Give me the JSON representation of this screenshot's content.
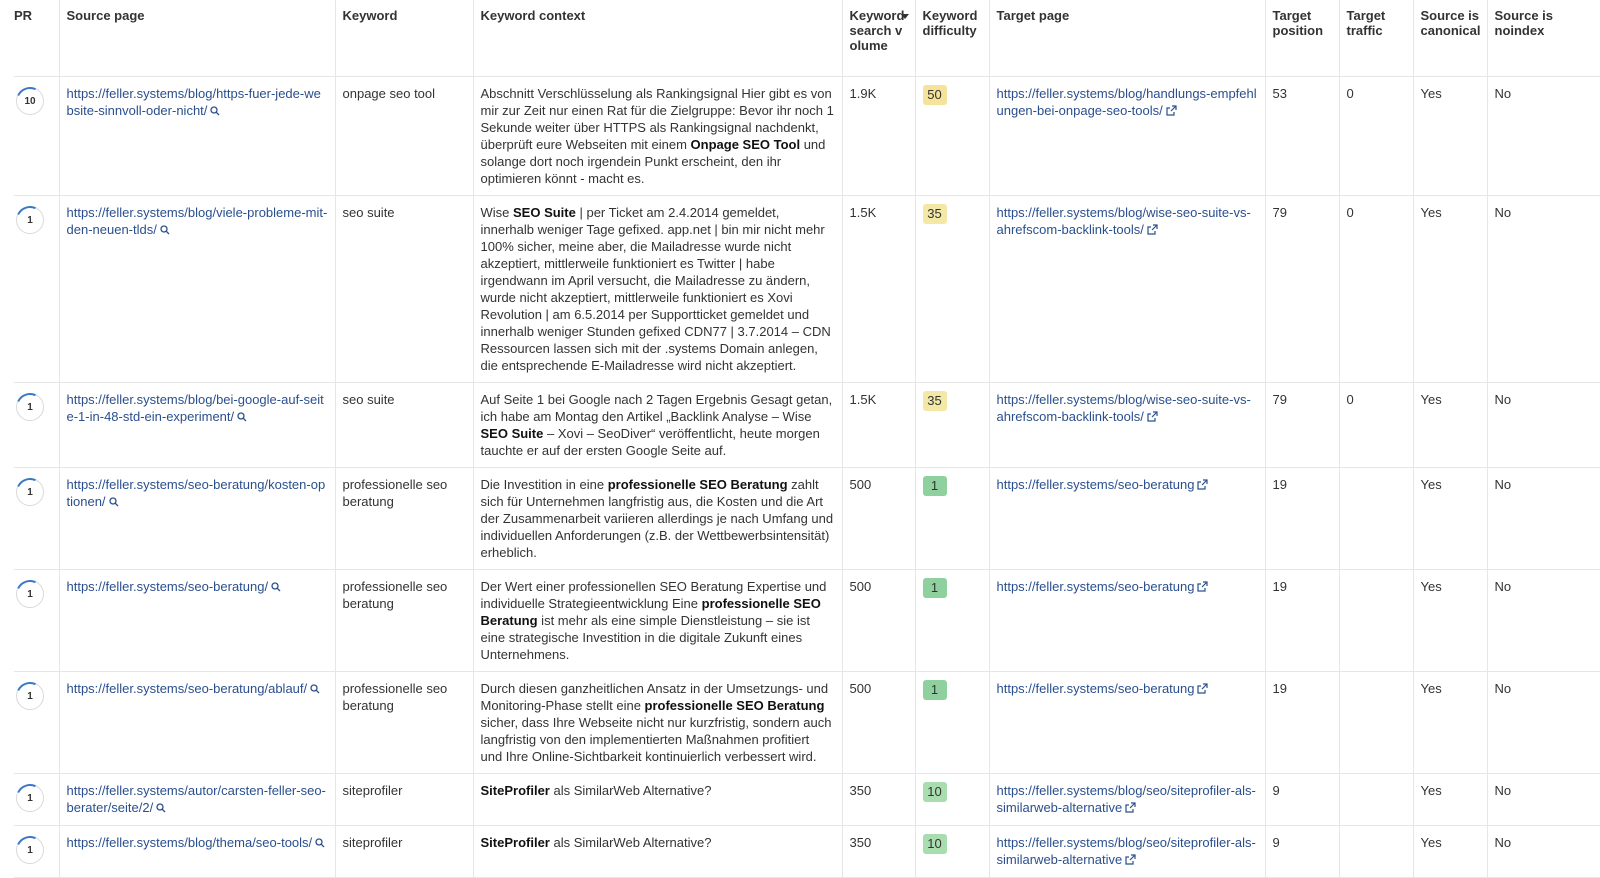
{
  "headers": {
    "pr": "PR",
    "source_page": "Source page",
    "keyword": "Keyword",
    "keyword_context": "Keyword context",
    "search_volume": "Keyword search volume",
    "difficulty": "Keyword difficulty",
    "target_page": "Target page",
    "target_position": "Target position",
    "target_traffic": "Target traffic",
    "canonical": "Source is canonical",
    "noindex": "Source is noindex"
  },
  "colors": {
    "kd_yellow": "#f5e39a",
    "kd_lightyellow": "#f3e8a6",
    "kd_green": "#8fd19e",
    "kd_lightgreen": "#a9dcae",
    "link": "#2a4f8e"
  },
  "rows": [
    {
      "pr": "10",
      "source": "https://feller.systems/blog/https-fuer-jede-website-sinnvoll-oder-nicht/",
      "keyword": "onpage seo tool",
      "context": [
        {
          "t": "Abschnitt Verschlüsselung als Rankingsignal Hier gibt es von mir zur Zeit nur einen Rat für die Zielgruppe: Bevor ihr noch 1 Sekunde weiter über HTTPS als Rankingsignal nachdenkt, überprüft eure Webseiten mit einem ",
          "b": false
        },
        {
          "t": "Onpage SEO Tool",
          "b": true
        },
        {
          "t": " und solange dort noch irgendein Punkt erscheint, den ihr optimieren könnt - macht es.",
          "b": false
        }
      ],
      "volume": "1.9K",
      "kd": "50",
      "kd_color": "#f5e39a",
      "target": "https://feller.systems/blog/handlungs-empfehlungen-bei-onpage-seo-tools/",
      "position": "53",
      "traffic": "0",
      "canonical": "Yes",
      "noindex": "No"
    },
    {
      "pr": "1",
      "source": "https://feller.systems/blog/viele-probleme-mit-den-neuen-tlds/",
      "keyword": "seo suite",
      "context": [
        {
          "t": "Wise ",
          "b": false
        },
        {
          "t": "SEO Suite",
          "b": true
        },
        {
          "t": " | per Ticket am 2.4.2014 gemeldet, innerhalb weniger Tage gefixed. app.net | bin mir nicht mehr 100% sicher, meine aber, die Mailadresse wurde nicht akzeptiert, mittlerweile funktioniert es Twitter | habe irgendwann im April versucht, die Mailadresse zu ändern, wurde nicht akzeptiert, mittlerweile funktioniert es Xovi Revolution | am 6.5.2014 per Supportticket gemeldet und innerhalb weniger Stunden gefixed CDN77 | 3.7.2014 – CDN Ressourcen lassen sich mit der .systems Domain anlegen, die entsprechende E-Mailadresse wird nicht akzeptiert.",
          "b": false
        }
      ],
      "volume": "1.5K",
      "kd": "35",
      "kd_color": "#f3e8a6",
      "target": "https://feller.systems/blog/wise-seo-suite-vs-ahrefscom-backlink-tools/",
      "position": "79",
      "traffic": "0",
      "canonical": "Yes",
      "noindex": "No"
    },
    {
      "pr": "1",
      "source": "https://feller.systems/blog/bei-google-auf-seite-1-in-48-std-ein-experiment/",
      "keyword": "seo suite",
      "context": [
        {
          "t": "Auf Seite 1 bei Google nach 2 Tagen Ergebnis Gesagt getan, ich habe am Montag den Artikel „Backlink Analyse – Wise ",
          "b": false
        },
        {
          "t": "SEO Suite",
          "b": true
        },
        {
          "t": " – Xovi – SeoDiver“ veröffentlicht, heute morgen tauchte er auf der ersten Google Seite auf.",
          "b": false
        }
      ],
      "volume": "1.5K",
      "kd": "35",
      "kd_color": "#f3e8a6",
      "target": "https://feller.systems/blog/wise-seo-suite-vs-ahrefscom-backlink-tools/",
      "position": "79",
      "traffic": "0",
      "canonical": "Yes",
      "noindex": "No"
    },
    {
      "pr": "1",
      "source": "https://feller.systems/seo-beratung/kosten-optionen/",
      "keyword": "professionelle seo beratung",
      "context": [
        {
          "t": "Die Investition in eine ",
          "b": false
        },
        {
          "t": "professionelle SEO Beratung",
          "b": true
        },
        {
          "t": " zahlt sich für Unternehmen langfristig aus, die Kosten und die Art der Zusammenarbeit variieren allerdings je nach Umfang und individuellen Anforderungen (z.B. der Wettbewerbsintensität) erheblich.",
          "b": false
        }
      ],
      "volume": "500",
      "kd": "1",
      "kd_color": "#8fd19e",
      "target": "https://feller.systems/seo-beratung",
      "position": "19",
      "traffic": "",
      "canonical": "Yes",
      "noindex": "No"
    },
    {
      "pr": "1",
      "source": "https://feller.systems/seo-beratung/",
      "keyword": "professionelle seo beratung",
      "context": [
        {
          "t": "Der Wert einer professionellen SEO Beratung Expertise und individuelle Strategieentwicklung Eine ",
          "b": false
        },
        {
          "t": "professionelle SEO Beratung",
          "b": true
        },
        {
          "t": " ist mehr als eine simple Dienstleistung – sie ist eine strategische Investition in die digitale Zukunft eines Unternehmens.",
          "b": false
        }
      ],
      "volume": "500",
      "kd": "1",
      "kd_color": "#8fd19e",
      "target": "https://feller.systems/seo-beratung",
      "position": "19",
      "traffic": "",
      "canonical": "Yes",
      "noindex": "No"
    },
    {
      "pr": "1",
      "source": "https://feller.systems/seo-beratung/ablauf/",
      "keyword": "professionelle seo beratung",
      "context": [
        {
          "t": "Durch diesen ganzheitlichen Ansatz in der Umsetzungs- und Monitoring-Phase stellt eine ",
          "b": false
        },
        {
          "t": "professionelle SEO Beratung",
          "b": true
        },
        {
          "t": " sicher, dass Ihre Webseite nicht nur kurzfristig, sondern auch langfristig von den implementierten Maßnahmen profitiert und Ihre Online-Sichtbarkeit kontinuierlich verbessert wird.",
          "b": false
        }
      ],
      "volume": "500",
      "kd": "1",
      "kd_color": "#8fd19e",
      "target": "https://feller.systems/seo-beratung",
      "position": "19",
      "traffic": "",
      "canonical": "Yes",
      "noindex": "No"
    },
    {
      "pr": "1",
      "source": "https://feller.systems/autor/carsten-feller-seo-berater/seite/2/",
      "keyword": "siteprofiler",
      "context": [
        {
          "t": "SiteProfiler",
          "b": true
        },
        {
          "t": " als SimilarWeb Alternative?",
          "b": false
        }
      ],
      "volume": "350",
      "kd": "10",
      "kd_color": "#a9dcae",
      "target": "https://feller.systems/blog/seo/siteprofiler-als-similarweb-alternative",
      "position": "9",
      "traffic": "",
      "canonical": "Yes",
      "noindex": "No"
    },
    {
      "pr": "1",
      "source": "https://feller.systems/blog/thema/seo-tools/",
      "keyword": "siteprofiler",
      "context": [
        {
          "t": "SiteProfiler",
          "b": true
        },
        {
          "t": " als SimilarWeb Alternative?",
          "b": false
        }
      ],
      "volume": "350",
      "kd": "10",
      "kd_color": "#a9dcae",
      "target": "https://feller.systems/blog/seo/siteprofiler-als-similarweb-alternative",
      "position": "9",
      "traffic": "",
      "canonical": "Yes",
      "noindex": "No"
    }
  ]
}
